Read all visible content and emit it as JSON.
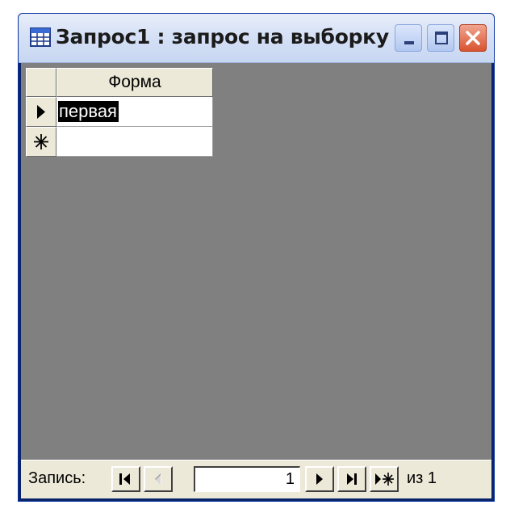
{
  "window": {
    "title": "Запрос1 : запрос на выборку",
    "icon": "datasheet-icon"
  },
  "grid": {
    "columns": [
      "Форма"
    ],
    "rows": [
      {
        "selector": "current-record-arrow",
        "value": "первая",
        "selected": true
      },
      {
        "selector": "new-record-asterisk",
        "value": ""
      }
    ]
  },
  "navigation": {
    "label": "Запись:",
    "current_record": "1",
    "of_label": "из 1",
    "buttons": [
      "first-record",
      "previous-record",
      "next-record",
      "last-record",
      "new-record"
    ]
  },
  "colors": {
    "workspace": "#808080",
    "chrome": "#ece9d8",
    "close_button": "#d9532f"
  }
}
